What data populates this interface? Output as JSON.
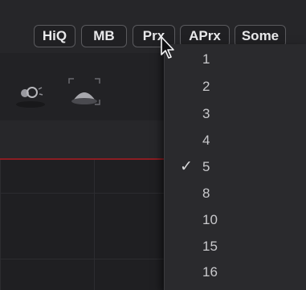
{
  "toolbar": {
    "buttons": [
      "HiQ",
      "MB",
      "Prx",
      "APrx",
      "Some"
    ]
  },
  "proxy_menu": {
    "options": [
      "1",
      "2",
      "3",
      "4",
      "5",
      "8",
      "10",
      "15",
      "16"
    ],
    "selected": "5",
    "check_glyph": "✓"
  },
  "icons": {
    "tool_1": "light-tool-icon",
    "tool_2": "dome-tool-icon",
    "cursor": "mouse-pointer-icon"
  },
  "colors": {
    "timeline_marker": "#8b1d22",
    "menu_background": "#2a2a2d",
    "button_border": "#5a5a5e"
  }
}
